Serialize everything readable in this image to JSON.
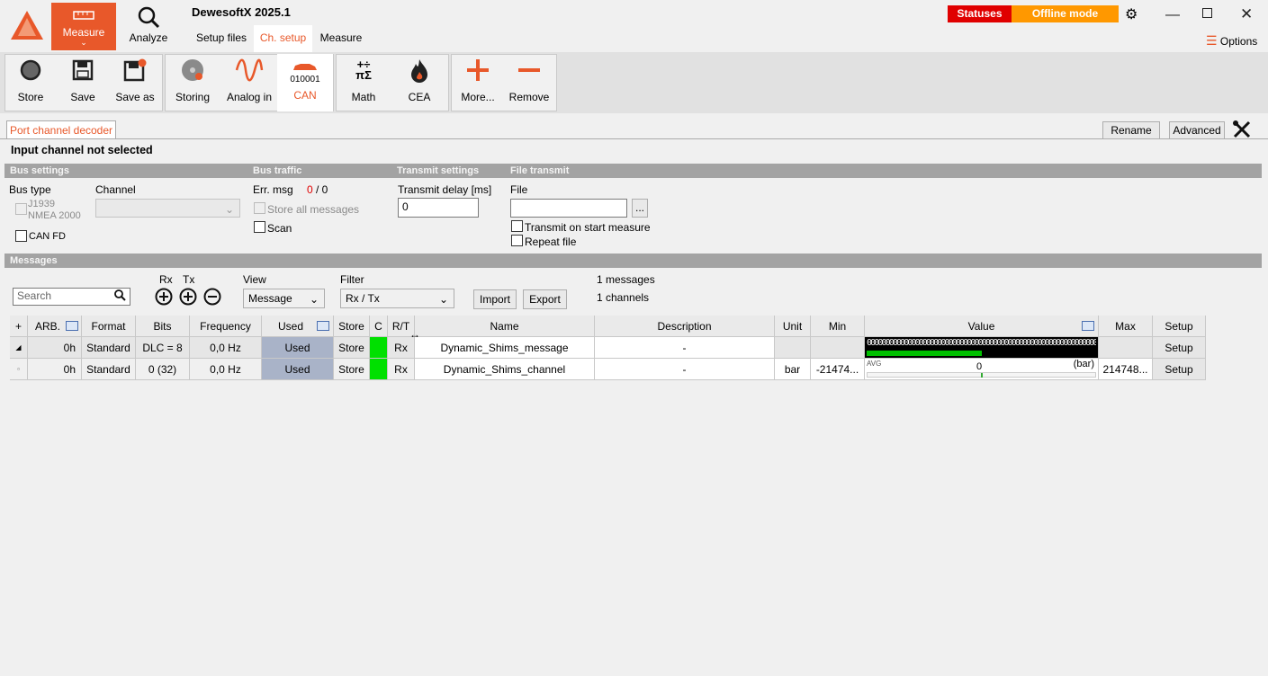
{
  "app": {
    "title": "DewesoftX 2025.1"
  },
  "nav": {
    "measure_label": "Measure",
    "analyze_label": "Analyze",
    "tabs": [
      "Setup files",
      "Ch. setup",
      "Measure"
    ],
    "statuses_label": "Statuses",
    "offline_label": "Offline mode",
    "options_label": "Options"
  },
  "ribbon": {
    "store": "Store",
    "save": "Save",
    "save_as": "Save as",
    "storing": "Storing",
    "analog_in": "Analog in",
    "can": "CAN",
    "can_code": "010001",
    "math": "Math",
    "cea": "CEA",
    "more": "More...",
    "remove": "Remove"
  },
  "panel": {
    "tab_label": "Port channel decoder",
    "rename_label": "Rename",
    "advanced_label": "Advanced",
    "status_title": "Input channel not selected"
  },
  "bus_settings": {
    "header": "Bus settings",
    "bus_type_label": "Bus type",
    "bus_type_options": [
      "J1939",
      "NMEA 2000"
    ],
    "channel_label": "Channel",
    "channel_value": "",
    "can_fd_label": "CAN FD"
  },
  "bus_traffic": {
    "header": "Bus traffic",
    "err_msg_label": "Err. msg",
    "err_count": "0",
    "err_sep": "/ 0",
    "store_all_label": "Store all messages",
    "scan_label": "Scan"
  },
  "transmit_settings": {
    "header": "Transmit settings",
    "delay_label": "Transmit delay [ms]",
    "delay_value": "0"
  },
  "file_transmit": {
    "header": "File transmit",
    "file_label": "File",
    "file_value": "",
    "browse_label": "...",
    "transmit_on_start_label": "Transmit on start measure",
    "repeat_file_label": "Repeat file"
  },
  "messages": {
    "header": "Messages",
    "search_placeholder": "Search",
    "rx_label": "Rx",
    "tx_label": "Tx",
    "view_label": "View",
    "view_value": "Message",
    "filter_label": "Filter",
    "filter_value": "Rx / Tx",
    "import_label": "Import",
    "export_label": "Export",
    "messages_count": "1 messages",
    "channels_count": "1 channels"
  },
  "table": {
    "headers": {
      "plus": "+",
      "arb": "ARB.",
      "format": "Format",
      "bits": "Bits",
      "frequency": "Frequency",
      "used": "Used",
      "store": "Store",
      "c": "C",
      "rt": "R/T",
      "name": "Name",
      "description": "Description",
      "unit": "Unit",
      "min": "Min",
      "value": "Value",
      "max": "Max",
      "setup": "Setup"
    },
    "rows": [
      {
        "arb": "0h",
        "format": "Standard",
        "bits": "DLC = 8",
        "frequency": "0,0 Hz",
        "used": "Used",
        "store": "Store",
        "rt": "Rx",
        "name": "Dynamic_Shims_message",
        "description": "-",
        "unit": "",
        "min": "",
        "value_bits": "0000000000000000000000000000000000000000000000000000000000000000",
        "max": "",
        "setup": "Setup",
        "fill": 0.5
      },
      {
        "arb": "0h",
        "format": "Standard",
        "bits": "0 (32)",
        "frequency": "0,0 Hz",
        "used": "Used",
        "store": "Store",
        "rt": "Rx",
        "name": "Dynamic_Shims_channel",
        "description": "-",
        "unit": "bar",
        "min": "-21474...",
        "value_avg": "AVG",
        "value": "0",
        "value_unit": "(bar)",
        "max": "214748...",
        "setup": "Setup"
      }
    ]
  },
  "colors": {
    "accent": "#e8582a",
    "statuses": "#e00000",
    "offline": "#ff9800",
    "used": "#a9b3c8",
    "green": "#00e000"
  }
}
